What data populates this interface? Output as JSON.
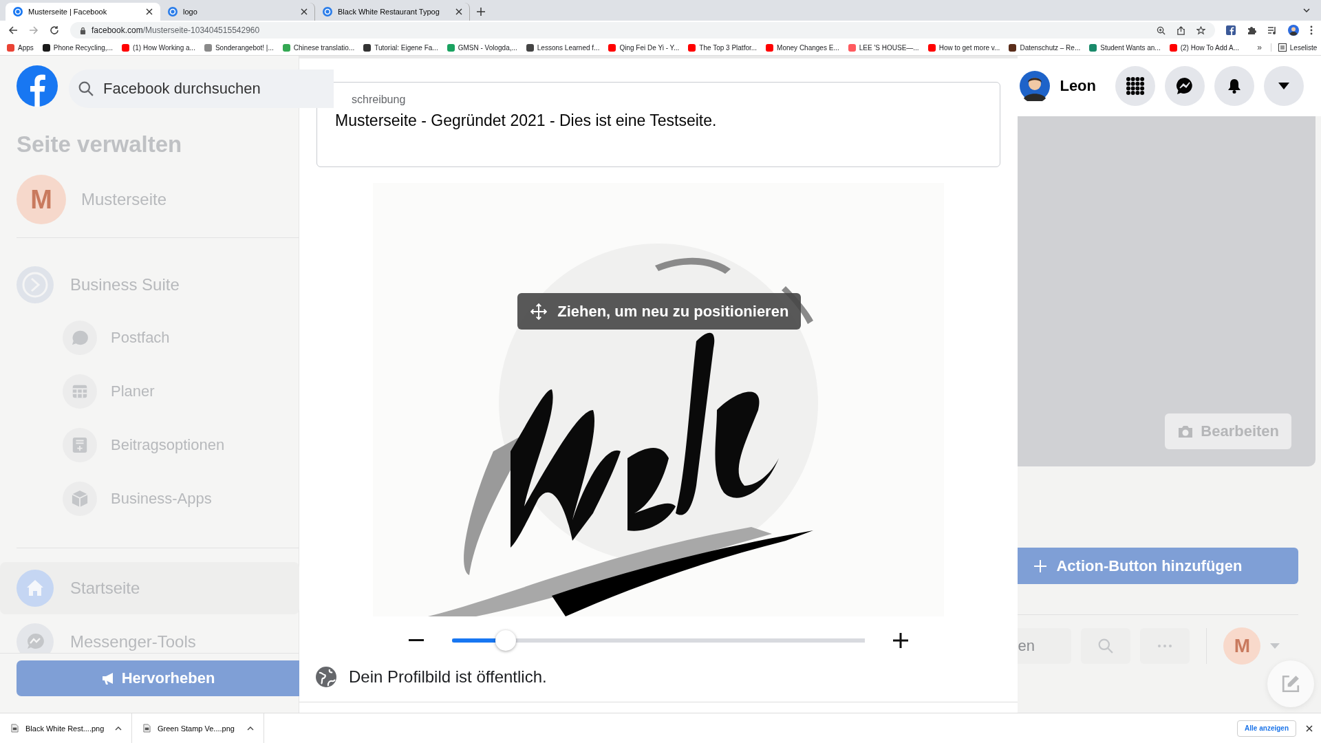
{
  "browser": {
    "tabs": [
      {
        "title": "Musterseite | Facebook",
        "selected": true
      },
      {
        "title": "logo",
        "selected": false
      },
      {
        "title": "Black White Restaurant Typog",
        "selected": false
      }
    ],
    "url": {
      "domain": "facebook.com",
      "path": "/Musterseite-103404515542960"
    },
    "bookmarks": [
      {
        "label": "Apps",
        "color": "#ea4335"
      },
      {
        "label": "Phone Recycling,...",
        "color": "#1a1a1a"
      },
      {
        "label": "(1) How Working a...",
        "color": "#ff0000"
      },
      {
        "label": "Sonderangebot! |...",
        "color": "#8a8a8a"
      },
      {
        "label": "Chinese translatio...",
        "color": "#34a853"
      },
      {
        "label": "Tutorial: Eigene Fa...",
        "color": "#333333"
      },
      {
        "label": "GMSN - Vologda,...",
        "color": "#1aa260"
      },
      {
        "label": "Lessons Learned f...",
        "color": "#444444"
      },
      {
        "label": "Qing Fei De Yi - Y...",
        "color": "#ff0000"
      },
      {
        "label": "The Top 3 Platfor...",
        "color": "#ff0000"
      },
      {
        "label": "Money Changes E...",
        "color": "#ff0000"
      },
      {
        "label": "LEE 'S HOUSE—...",
        "color": "#ff5a5f"
      },
      {
        "label": "How to get more v...",
        "color": "#ff0000"
      },
      {
        "label": "Datenschutz – Re...",
        "color": "#5a2d1a"
      },
      {
        "label": "Student Wants an...",
        "color": "#1a8a6a"
      },
      {
        "label": "(2) How To Add A...",
        "color": "#ff0000"
      }
    ],
    "more_bookmarks": "»",
    "reading_list": "Leseliste"
  },
  "header": {
    "search": {
      "placeholder": "Facebook durchsuchen"
    },
    "user": "Leon"
  },
  "sidebar": {
    "title": "Seite verwalten",
    "page": {
      "initial": "M",
      "name": "Musterseite"
    },
    "business_suite": "Business Suite",
    "items": [
      {
        "label": "Postfach",
        "kind": "chat"
      },
      {
        "label": "Planer",
        "kind": "table"
      },
      {
        "label": "Beitragsoptionen",
        "kind": "post"
      },
      {
        "label": "Business-Apps",
        "kind": "cube"
      }
    ],
    "nav": [
      {
        "label": "Startseite",
        "selected": true,
        "kind": "home"
      },
      {
        "label": "Messenger-Tools",
        "selected": false,
        "kind": "messenger"
      }
    ],
    "promote_button": "Hervorheben"
  },
  "dialog": {
    "description": {
      "label": "schreibung",
      "value": "Musterseite - Gegründet 2021 - Dies ist eine Testseite."
    },
    "tooltip": "Ziehen, um neu zu positionieren",
    "zoom": {
      "level": 0.13
    },
    "privacy_note": "Dein Profilbild ist öffentlich."
  },
  "page": {
    "edit_cover_button": "Bearbeiten",
    "action_button": "Action-Button hinzufügen",
    "tab_fragment": "en",
    "avatar_initial": "M"
  },
  "downloads": {
    "items": [
      "Black White Rest....png",
      "Green Stamp Ve....png"
    ],
    "show_all": "Alle anzeigen"
  }
}
